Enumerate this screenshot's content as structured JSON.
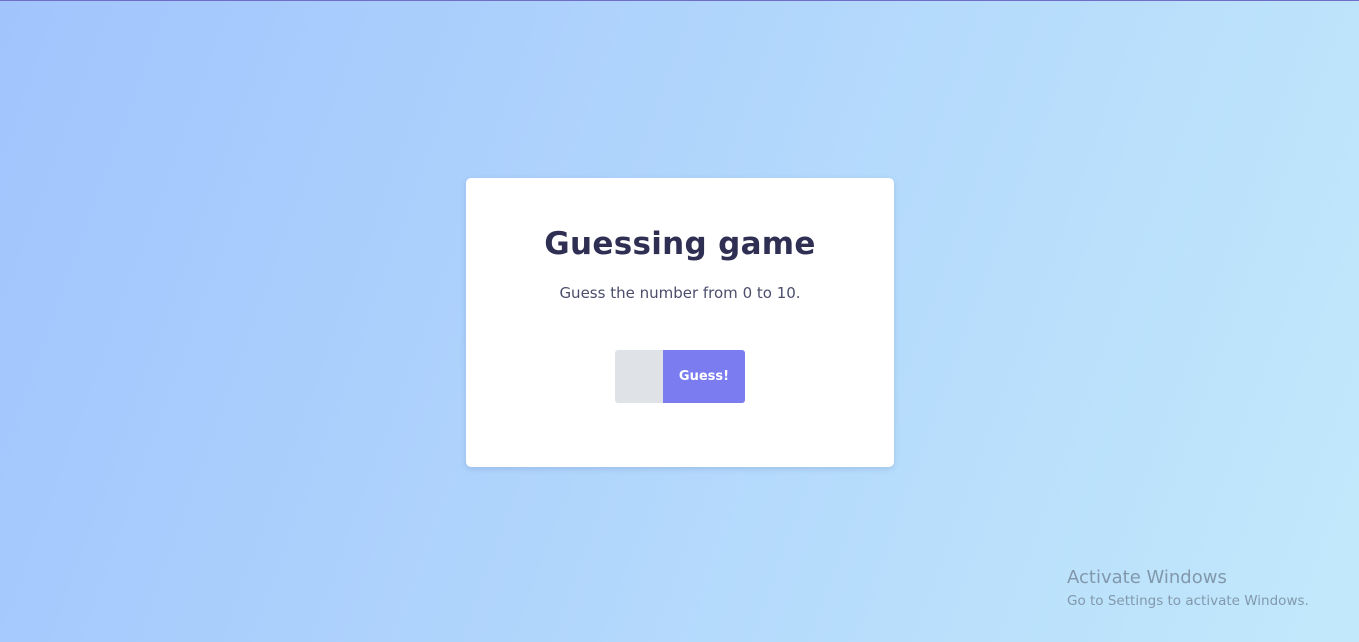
{
  "game": {
    "title": "Guessing game",
    "instructions": "Guess the number from 0 to 10.",
    "input_value": "",
    "button_label": "Guess!"
  },
  "watermark": {
    "title": "Activate Windows",
    "subtitle": "Go to Settings to activate Windows."
  },
  "colors": {
    "background_start": "#a1c4fd",
    "background_end": "#c2e9fb",
    "card": "#ffffff",
    "title_text": "#2e2f52",
    "input_bg": "#dfe3e8",
    "button_bg": "#7b7cf0",
    "button_text": "#ffffff"
  }
}
